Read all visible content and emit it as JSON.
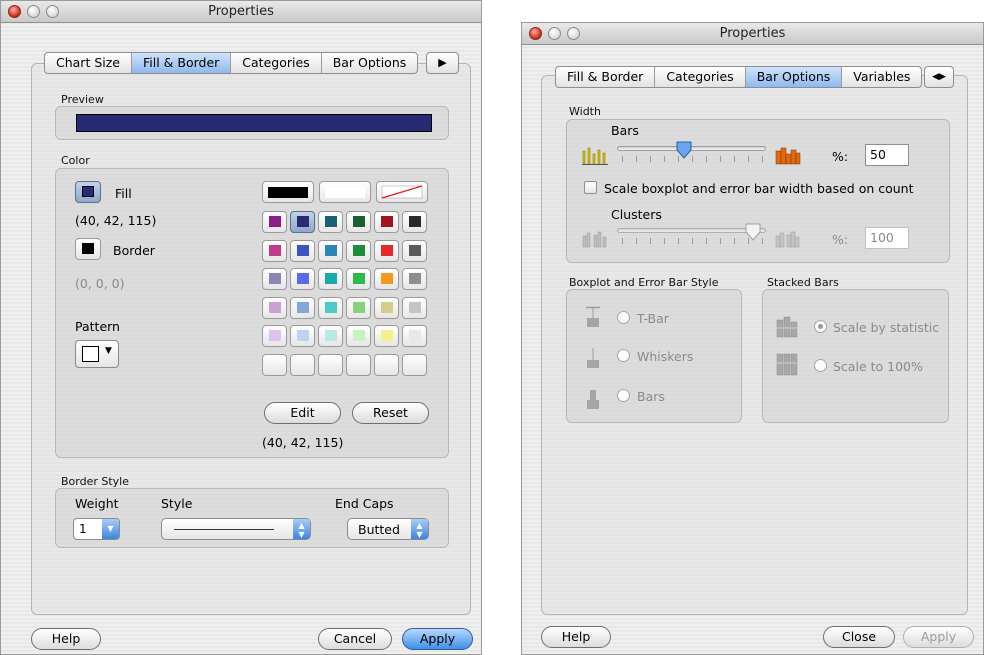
{
  "left_window": {
    "title": "Properties",
    "tabs": [
      "Chart Size",
      "Fill & Border",
      "Categories",
      "Bar Options"
    ],
    "selected_tab": "Fill & Border",
    "tab_more_arrow": "▶",
    "preview": {
      "label": "Preview",
      "color": "#282a73"
    },
    "color_group": {
      "label": "Color",
      "fill_label": "Fill",
      "fill_color": "#282a73",
      "fill_rgb": "(40, 42, 115)",
      "border_label": "Border",
      "border_color": "#000000",
      "border_rgb": "(0, 0, 0)",
      "pattern_label": "Pattern",
      "palette_rows": [
        [
          "#8b1f86",
          "#282a73",
          "#1b6173",
          "#1a6030",
          "#a0151e",
          "#2a2a2a"
        ],
        [
          "#c23b8a",
          "#3e54c0",
          "#2d86b8",
          "#1e8a3d",
          "#e32a2a",
          "#5a5a5a"
        ],
        [
          "#8a87b5",
          "#5a6af0",
          "#1aa8a8",
          "#2dba4c",
          "#f39a1e",
          "#8e8e8e"
        ],
        [
          "#c7a2d0",
          "#85a6d8",
          "#4ec8c8",
          "#83d37a",
          "#d6cc8a",
          "#c4c4c4"
        ],
        [
          "#dfc3ee",
          "#bcd2f0",
          "#b6e8e6",
          "#c9f2c2",
          "#f6f08a",
          "#e8e8e8"
        ],
        [
          "",
          "",
          "",
          "",
          "",
          ""
        ]
      ],
      "edit_label": "Edit",
      "reset_label": "Reset",
      "selected_rgb": "(40, 42, 115)"
    },
    "border_style": {
      "label": "Border Style",
      "weight_label": "Weight",
      "weight_value": "1",
      "style_label": "Style",
      "end_caps_label": "End Caps",
      "end_caps_value": "Butted"
    },
    "help_label": "Help",
    "cancel_label": "Cancel",
    "apply_label": "Apply"
  },
  "right_window": {
    "title": "Properties",
    "tabs": [
      "Fill & Border",
      "Categories",
      "Bar Options",
      "Variables"
    ],
    "selected_tab": "Bar Options",
    "tab_more_arrow": "◀▶",
    "width_group": {
      "label": "Width",
      "bars_label": "Bars",
      "bars_percent_label": "%:",
      "bars_percent_value": "50",
      "bars_slider_fraction": 0.44,
      "scale_checkbox_label": "Scale boxplot and error bar width based on count",
      "scale_checkbox_checked": false,
      "clusters_label": "Clusters",
      "clusters_percent_label": "%:",
      "clusters_percent_value": "100",
      "clusters_slider_fraction": 0.96
    },
    "boxplot_group": {
      "label": "Boxplot and Error Bar Style",
      "options": [
        "T-Bar",
        "Whiskers",
        "Bars"
      ]
    },
    "stacked_group": {
      "label": "Stacked Bars",
      "options": [
        "Scale by statistic",
        "Scale to 100%"
      ],
      "selected": "Scale by statistic"
    },
    "help_label": "Help",
    "close_label": "Close",
    "apply_label": "Apply"
  }
}
